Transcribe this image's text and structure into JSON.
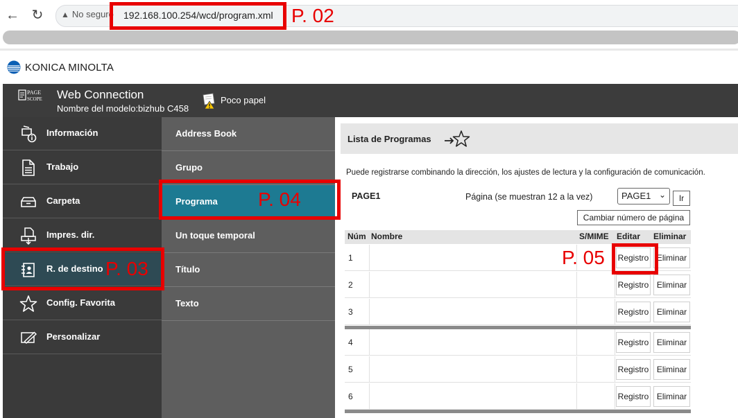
{
  "browser": {
    "back_icon": "back-arrow-icon",
    "reload_icon": "reload-icon",
    "security_text": "No seguro",
    "url": "192.168.100.254/wcd/program.xml"
  },
  "annotations": {
    "url": "P. 02",
    "menu": "P. 03",
    "submenu": "P. 04",
    "register": "P. 05"
  },
  "brand": {
    "name": "KONICA MINOLTA"
  },
  "header": {
    "logo_text_top": "PAGE",
    "logo_text_bottom": "SCOPE",
    "title": "Web Connection",
    "model": "Nombre del modelo:bizhub C458",
    "status": "Poco papel"
  },
  "main_menu": [
    {
      "label": "Información",
      "icon": "info-icon"
    },
    {
      "label": "Trabajo",
      "icon": "document-icon"
    },
    {
      "label": "Carpeta",
      "icon": "folder-tray-icon"
    },
    {
      "label": "Impres. dir.",
      "icon": "direct-print-icon"
    },
    {
      "label": "R. de destino",
      "icon": "address-book-icon",
      "active": true
    },
    {
      "label": "Config. Favorita",
      "icon": "star-icon"
    },
    {
      "label": "Personalizar",
      "icon": "customize-icon"
    }
  ],
  "sub_menu": [
    {
      "label": "Address Book"
    },
    {
      "label": "Grupo"
    },
    {
      "label": "Programa",
      "active": true
    },
    {
      "label": "Un toque temporal"
    },
    {
      "label": "Título"
    },
    {
      "label": "Texto"
    }
  ],
  "content": {
    "title": "Lista de Programas",
    "description": "Puede registrarse combinando la dirección, los ajustes de lectura y la configuración de comunicación.",
    "page_name": "PAGE1",
    "page_info": "Página (se muestran 12 a la vez)",
    "page_select": "PAGE1",
    "go_label": "Ir",
    "change_page_label": "Cambiar número de página"
  },
  "table": {
    "headers": {
      "num": "Núm",
      "name": "Nombre",
      "smime": "S/MIME",
      "edit": "Editar",
      "delete": "Eliminar"
    },
    "rows": [
      {
        "num": "1",
        "edit": "Registro",
        "delete": "Eliminar"
      },
      {
        "num": "2",
        "edit": "Registro",
        "delete": "Eliminar"
      },
      {
        "num": "3",
        "edit": "Registro",
        "delete": "Eliminar"
      },
      {
        "num": "4",
        "edit": "Registro",
        "delete": "Eliminar"
      },
      {
        "num": "5",
        "edit": "Registro",
        "delete": "Eliminar"
      },
      {
        "num": "6",
        "edit": "Registro",
        "delete": "Eliminar"
      }
    ]
  },
  "colors": {
    "annotation": "#e80000",
    "header_bg": "#3c3c3c",
    "menu_bg": "#3a3a3a",
    "submenu_bg": "#5e5e5e",
    "submenu_active": "#1d7a92",
    "menu_active": "#2e4a54"
  }
}
